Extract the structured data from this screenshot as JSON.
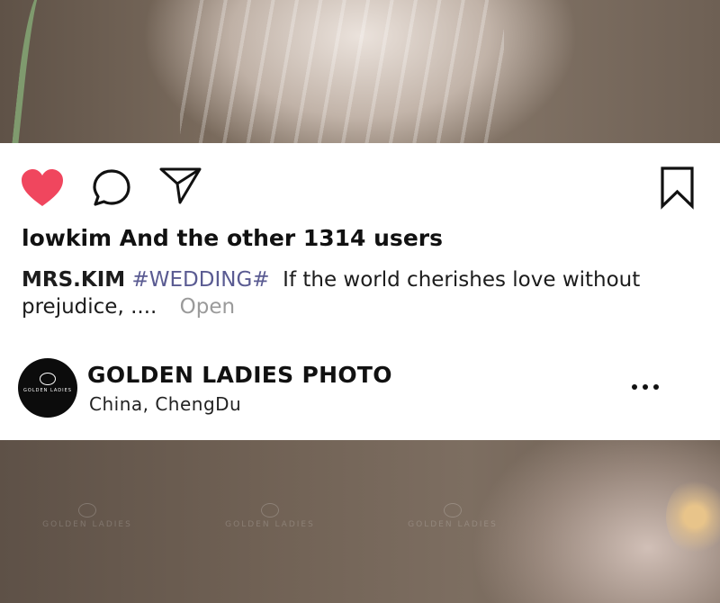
{
  "post": {
    "likes_text": "lowkim And the other 1314 users",
    "caption": {
      "username": "MRS.KIM",
      "hashtag": "#WEDDING#",
      "text": "If the world cherishes love without prejudice, ....",
      "open_label": "Open"
    },
    "liked": true,
    "like_color": "#f0465e"
  },
  "account": {
    "name": "GOLDEN LADIES PHOTO",
    "location": "China, ChengDu",
    "avatar_text": "GOLDEN LADIES"
  },
  "icons": {
    "like": "heart-icon",
    "comment": "comment-bubble-icon",
    "share": "paper-plane-icon",
    "save": "bookmark-icon",
    "more": "more-dots-icon"
  },
  "watermark": "GOLDEN LADIES"
}
